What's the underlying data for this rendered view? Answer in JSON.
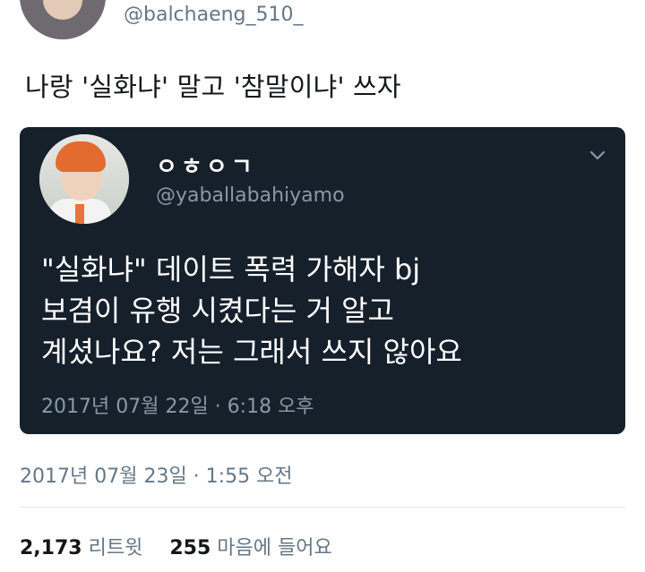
{
  "author": {
    "handle": "@balchaeng_510_"
  },
  "tweet": {
    "text": "나랑 '실화냐' 말고 '참말이냐' 쓰자",
    "timestamp": "2017년 07월 23일 · 1:55 오전"
  },
  "quoted_tweet": {
    "name": "ㅇㅎㅇㄱ",
    "handle": "@yaballabahiyamo",
    "body_lines": [
      "\"실화냐\" 데이트 폭력 가해자 bj",
      "보겸이 유행 시켰다는 거 알고",
      "계셨나요? 저는 그래서 쓰지 않아요"
    ],
    "timestamp": "2017년 07월 22일 · 6:18 오후",
    "menu_icon": "chevron-down-icon",
    "background": "#15202b"
  },
  "stats": {
    "retweets_count": "2,173",
    "retweets_label": "리트윗",
    "likes_count": "255",
    "likes_label": "마음에 들어요"
  }
}
